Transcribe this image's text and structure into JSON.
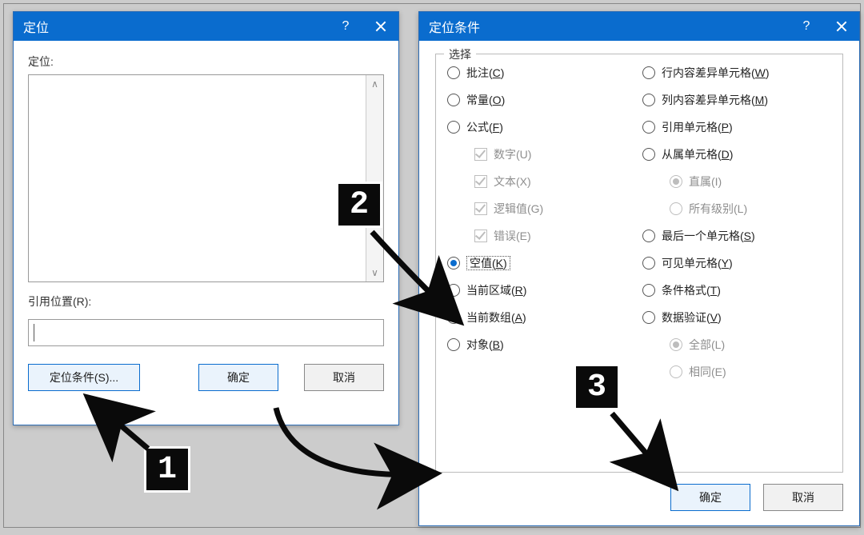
{
  "left": {
    "title": "定位",
    "label_list": "定位:",
    "label_ref": "引用位置(R):",
    "ref_value": "",
    "btn_special": "定位条件(S)...",
    "btn_ok": "确定",
    "btn_cancel": "取消"
  },
  "right": {
    "title": "定位条件",
    "legend": "选择",
    "left_options": [
      {
        "kind": "radio",
        "label_pre": "批注(",
        "hot": "C",
        "label_post": ")",
        "checked": false
      },
      {
        "kind": "radio",
        "label_pre": "常量(",
        "hot": "O",
        "label_post": ")",
        "checked": false
      },
      {
        "kind": "radio",
        "label_pre": "公式(",
        "hot": "F",
        "label_post": ")",
        "checked": false
      },
      {
        "kind": "chk-sub-disabled",
        "label": "数字(U)",
        "checked": true
      },
      {
        "kind": "chk-sub-disabled",
        "label": "文本(X)",
        "checked": true
      },
      {
        "kind": "chk-sub-disabled",
        "label": "逻辑值(G)",
        "checked": true
      },
      {
        "kind": "chk-sub-disabled",
        "label": "错误(E)",
        "checked": true
      },
      {
        "kind": "radio",
        "label_pre": "空值(",
        "hot": "K",
        "label_post": ")",
        "checked": true,
        "focused": true
      },
      {
        "kind": "radio",
        "label_pre": "当前区域(",
        "hot": "R",
        "label_post": ")",
        "checked": false
      },
      {
        "kind": "radio",
        "label_pre": "当前数组(",
        "hot": "A",
        "label_post": ")",
        "checked": false
      },
      {
        "kind": "radio",
        "label_pre": "对象(",
        "hot": "B",
        "label_post": ")",
        "checked": false
      }
    ],
    "right_options": [
      {
        "kind": "radio",
        "label_pre": "行内容差异单元格(",
        "hot": "W",
        "label_post": ")",
        "checked": false
      },
      {
        "kind": "radio",
        "label_pre": "列内容差异单元格(",
        "hot": "M",
        "label_post": ")",
        "checked": false
      },
      {
        "kind": "radio",
        "label_pre": "引用单元格(",
        "hot": "P",
        "label_post": ")",
        "checked": false
      },
      {
        "kind": "radio",
        "label_pre": "从属单元格(",
        "hot": "D",
        "label_post": ")",
        "checked": false
      },
      {
        "kind": "radio-sub-disabled",
        "label": "直属(I)",
        "checked": true
      },
      {
        "kind": "radio-sub-disabled",
        "label": "所有级别(L)",
        "checked": false
      },
      {
        "kind": "radio",
        "label_pre": "最后一个单元格(",
        "hot": "S",
        "label_post": ")",
        "checked": false
      },
      {
        "kind": "radio",
        "label_pre": "可见单元格(",
        "hot": "Y",
        "label_post": ")",
        "checked": false
      },
      {
        "kind": "radio",
        "label_pre": "条件格式(",
        "hot": "T",
        "label_post": ")",
        "checked": false
      },
      {
        "kind": "radio",
        "label_pre": "数据验证(",
        "hot": "V",
        "label_post": ")",
        "checked": false
      },
      {
        "kind": "radio-sub-disabled",
        "label": "全部(L)",
        "checked": true
      },
      {
        "kind": "radio-sub-disabled",
        "label": "相同(E)",
        "checked": false
      }
    ],
    "btn_ok": "确定",
    "btn_cancel": "取消"
  },
  "annotations": {
    "b1": "1",
    "b2": "2",
    "b3": "3"
  }
}
